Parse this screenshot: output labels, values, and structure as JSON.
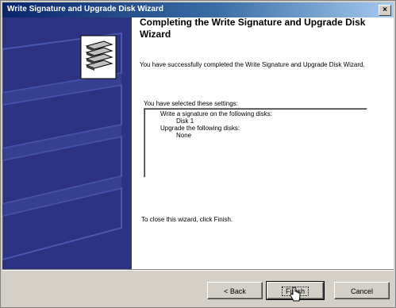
{
  "window": {
    "title": "Write Signature and Upgrade Disk Wizard",
    "close_glyph": "×"
  },
  "main": {
    "heading": "Completing the Write Signature and Upgrade Disk Wizard",
    "success_text": "You have successfully completed the Write Signature and Upgrade Disk Wizard.",
    "settings_label": "You have selected these settings:",
    "settings": {
      "line1": "Write a signature on the following disks:",
      "line2": "Disk 1",
      "line3": "Upgrade the following disks:",
      "line4": "None"
    },
    "close_instruction": "To close this wizard, click Finish."
  },
  "buttons": {
    "back": "< Back",
    "finish": "Finish",
    "cancel": "Cancel"
  },
  "colors": {
    "title_gradient_start": "#0a246a",
    "side_panel": "#2d3382",
    "dialog_face": "#d4d0c8"
  },
  "icons": {
    "wizard": "disk-stack-icon",
    "close": "close-icon",
    "cursor": "hand-pointer-icon"
  }
}
